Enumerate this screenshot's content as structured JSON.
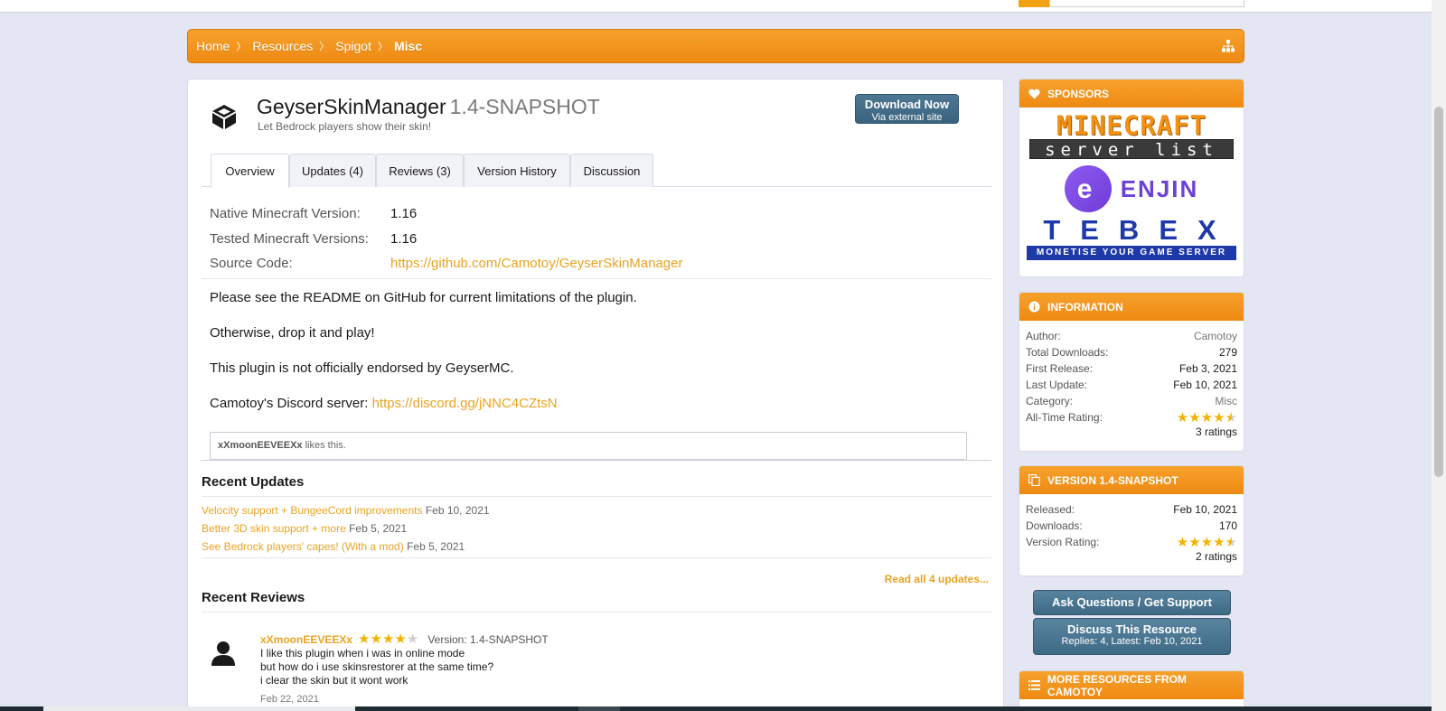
{
  "breadcrumb": [
    "Home",
    "Resources",
    "Spigot",
    "Misc"
  ],
  "resource": {
    "title": "GeyserSkinManager",
    "version": "1.4-SNAPSHOT",
    "tagline": "Let Bedrock players show their skin!",
    "download": {
      "label": "Download Now",
      "sub": "Via external site"
    }
  },
  "tabs": [
    "Overview",
    "Updates (4)",
    "Reviews (3)",
    "Version History",
    "Discussion"
  ],
  "details": [
    {
      "label": "Native Minecraft Version:",
      "value": "1.16"
    },
    {
      "label": "Tested Minecraft Versions:",
      "value": "1.16"
    },
    {
      "label": "Source Code:",
      "value": "https://github.com/Camotoy/GeyserSkinManager"
    }
  ],
  "description": {
    "p1": "Please see the README on GitHub for current limitations of the plugin.",
    "p2": "Otherwise, drop it and play!",
    "p3": "This plugin is not officially endorsed by GeyserMC.",
    "p4_text": "Camotoy's Discord server: ",
    "p4_link": "https://discord.gg/jNNC4CZtsN"
  },
  "likes": {
    "user": "xXmoonEEVEEXx",
    "text": " likes this."
  },
  "recent_updates": {
    "heading": "Recent Updates",
    "items": [
      {
        "title": "Velocity support + BungeeCord improvements",
        "date": "Feb 10, 2021"
      },
      {
        "title": "Better 3D skin support + more",
        "date": "Feb 5, 2021"
      },
      {
        "title": "See Bedrock players' capes! (With a mod)",
        "date": "Feb 5, 2021"
      }
    ],
    "read_all": "Read all 4 updates..."
  },
  "recent_reviews": {
    "heading": "Recent Reviews",
    "review": {
      "user": "xXmoonEEVEEXx",
      "rating": 4,
      "version": "Version: 1.4-SNAPSHOT",
      "lines": [
        "I like this plugin when i was in online mode",
        "but how do i use skinsrestorer at the same time?",
        "i clear the skin but it wont work"
      ],
      "date": "Feb 22, 2021"
    }
  },
  "sidebar": {
    "sponsors": {
      "heading": "SPONSORS",
      "mcsl_top": "MINECRAFT",
      "mcsl_bottom": "server list",
      "enjin": "ENJIN",
      "tebex": "TEBEX",
      "tebex_sub": "MONETISE YOUR GAME SERVER"
    },
    "information": {
      "heading": "INFORMATION",
      "rows": [
        {
          "k": "Author:",
          "v": "Camotoy"
        },
        {
          "k": "Total Downloads:",
          "v": "279"
        },
        {
          "k": "First Release:",
          "v": "Feb 3, 2021"
        },
        {
          "k": "Last Update:",
          "v": "Feb 10, 2021"
        },
        {
          "k": "Category:",
          "v": "Misc"
        }
      ],
      "rating_label": "All-Time Rating:",
      "rating": 4.5,
      "ratings_count": "3 ratings"
    },
    "version": {
      "heading": "VERSION 1.4-SNAPSHOT",
      "rows": [
        {
          "k": "Released:",
          "v": "Feb 10, 2021"
        },
        {
          "k": "Downloads:",
          "v": "170"
        }
      ],
      "rating_label": "Version Rating:",
      "rating": 4.5,
      "ratings_count": "2 ratings"
    },
    "ask_button": "Ask Questions / Get Support",
    "discuss": {
      "label": "Discuss This Resource",
      "sub": "Replies: 4, Latest: Feb 10, 2021"
    },
    "more": {
      "heading": "MORE RESOURCES FROM CAMOTOY"
    }
  },
  "colors": {
    "accent": "#ee8a12",
    "link": "#eba321",
    "button": "#3f6a86"
  }
}
